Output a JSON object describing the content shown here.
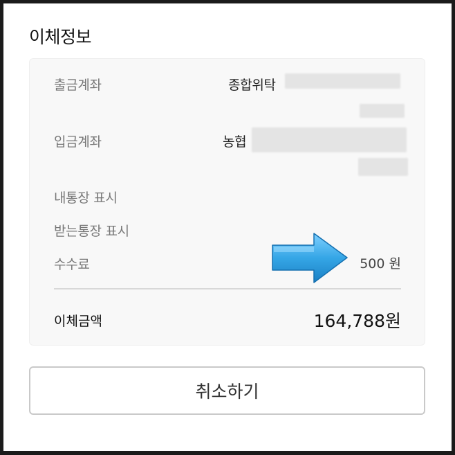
{
  "section_title": "이체정보",
  "rows": {
    "withdraw": {
      "label": "출금계좌",
      "value": "종합위탁"
    },
    "deposit": {
      "label": "입금계좌",
      "value": "농협"
    },
    "my_memo": {
      "label": "내통장 표시"
    },
    "recv_memo": {
      "label": "받는통장 표시"
    },
    "fee": {
      "label": "수수료",
      "value": "500 원"
    }
  },
  "total": {
    "label": "이체금액",
    "value": "164,788원"
  },
  "cancel_button": {
    "label": "취소하기"
  },
  "colors": {
    "arrow": "#3aa9e8",
    "card_bg": "#f8f8f8",
    "border": "#c9c9c9"
  }
}
